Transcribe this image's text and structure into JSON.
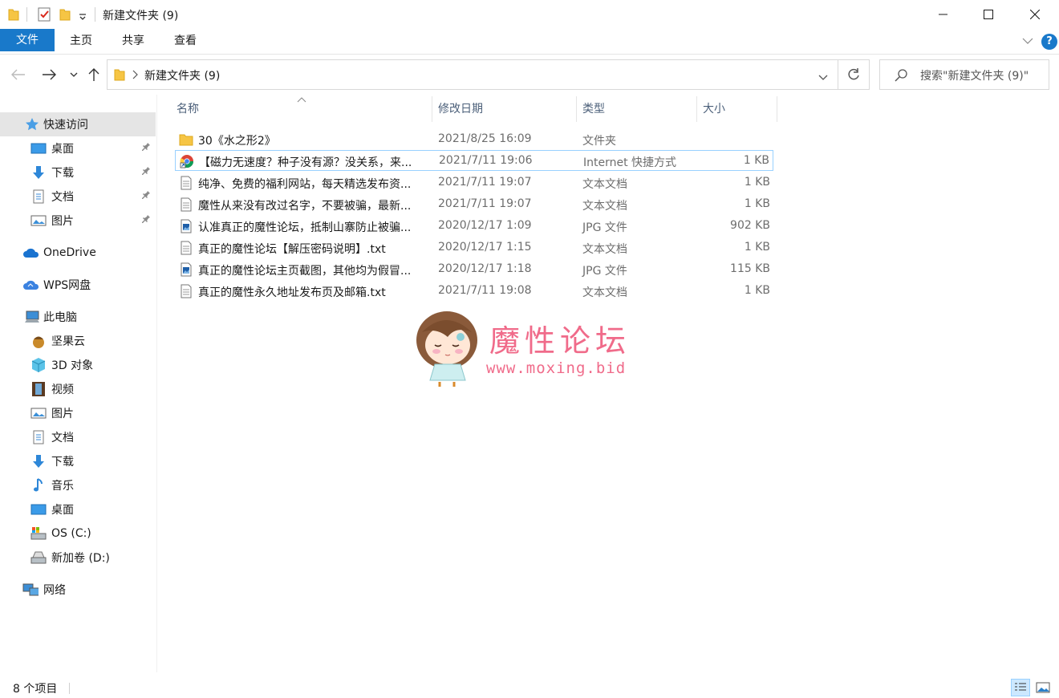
{
  "window": {
    "title": "新建文件夹 (9)",
    "minimize": "minimize",
    "maximize": "maximize",
    "close": "close"
  },
  "ribbon": {
    "tabs": [
      "文件",
      "主页",
      "共享",
      "查看"
    ],
    "help": "?"
  },
  "address": {
    "path": "新建文件夹 (9)",
    "search_placeholder": "搜索\"新建文件夹 (9)\""
  },
  "sidebar": {
    "quick_access": "快速访问",
    "quick_items": [
      "桌面",
      "下载",
      "文档",
      "图片"
    ],
    "onedrive": "OneDrive",
    "wps": "WPS网盘",
    "this_pc": "此电脑",
    "pc_items": [
      "坚果云",
      "3D 对象",
      "视频",
      "图片",
      "文档",
      "下载",
      "音乐",
      "桌面",
      "OS (C:)",
      "新加卷 (D:)"
    ],
    "network": "网络"
  },
  "columns": {
    "name": "名称",
    "date": "修改日期",
    "type": "类型",
    "size": "大小"
  },
  "files": [
    {
      "name": "30《水之形2》",
      "date": "2021/8/25 16:09",
      "type": "文件夹",
      "size": "",
      "icon": "folder-icon"
    },
    {
      "name": "【磁力无速度？种子没有源？没关系，来...",
      "date": "2021/7/11 19:06",
      "type": "Internet 快捷方式",
      "size": "1 KB",
      "icon": "chrome-shortcut-icon"
    },
    {
      "name": "纯净、免费的福利网站，每天精选发布资...",
      "date": "2021/7/11 19:07",
      "type": "文本文档",
      "size": "1 KB",
      "icon": "text-file-icon"
    },
    {
      "name": "魔性从来没有改过名字，不要被骗，最新...",
      "date": "2021/7/11 19:07",
      "type": "文本文档",
      "size": "1 KB",
      "icon": "text-file-icon"
    },
    {
      "name": "认准真正的魔性论坛，抵制山寨防止被骗...",
      "date": "2020/12/17 1:09",
      "type": "JPG 文件",
      "size": "902 KB",
      "icon": "image-file-icon"
    },
    {
      "name": "真正的魔性论坛【解压密码说明】.txt",
      "date": "2020/12/17 1:15",
      "type": "文本文档",
      "size": "1 KB",
      "icon": "text-file-icon"
    },
    {
      "name": "真正的魔性论坛主页截图，其他均为假冒...",
      "date": "2020/12/17 1:18",
      "type": "JPG 文件",
      "size": "115 KB",
      "icon": "image-file-icon"
    },
    {
      "name": "真正的魔性永久地址发布页及邮箱.txt",
      "date": "2021/7/11 19:08",
      "type": "文本文档",
      "size": "1 KB",
      "icon": "text-file-icon"
    }
  ],
  "watermark": {
    "title": "魔性论坛",
    "url": "www.moxing.bid"
  },
  "status": {
    "count": "8 个项目"
  },
  "colors": {
    "accent": "#1979ca",
    "watermark_pink": "#f06b8a",
    "selection": "#e5e5e5"
  }
}
